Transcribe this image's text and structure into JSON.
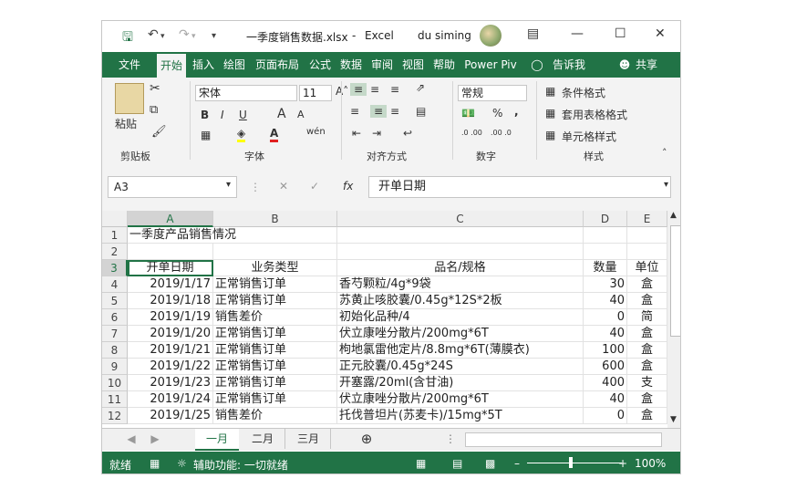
{
  "title_bar": {
    "file_name": "一季度销售数据.xlsx",
    "app": "Excel",
    "user": "du siming"
  },
  "tabs": [
    "文件",
    "开始",
    "插入",
    "绘图",
    "页面布局",
    "公式",
    "数据",
    "审阅",
    "视图",
    "帮助",
    "Power Piv",
    "告诉我",
    "共享"
  ],
  "ribbon": {
    "clipboard": {
      "paste": "粘贴",
      "label": "剪贴板"
    },
    "font": {
      "name": "宋体",
      "size": "11",
      "bold": "B",
      "italic": "I",
      "underline": "U",
      "grow": "A",
      "shrink": "A",
      "color": "A",
      "label": "字体"
    },
    "alignment": {
      "label": "对齐方式"
    },
    "number": {
      "format": "常规",
      "percent": "%",
      "comma": ",",
      "inc": ".0 .00",
      "dec": ".00 .0",
      "label": "数字"
    },
    "styles": {
      "conditional": "条件格式",
      "table": "套用表格格式",
      "cell": "单元格样式",
      "label": "样式"
    }
  },
  "formula_bar": {
    "name_box": "A3",
    "fx": "fx",
    "content": "开单日期"
  },
  "columns": [
    "A",
    "B",
    "C",
    "D",
    "E"
  ],
  "rows": [
    {
      "n": "1",
      "a": "一季度产品销售情况",
      "b": "",
      "c": "",
      "d": "",
      "e": ""
    },
    {
      "n": "2",
      "a": "",
      "b": "",
      "c": "",
      "d": "",
      "e": ""
    },
    {
      "n": "3",
      "a": "开单日期",
      "b": "业务类型",
      "c": "品名/规格",
      "d": "数量",
      "e": "单位"
    },
    {
      "n": "4",
      "a": "2019/1/17",
      "b": "正常销售订单",
      "c": "香芍颗粒/4g*9袋",
      "d": "30",
      "e": "盒"
    },
    {
      "n": "5",
      "a": "2019/1/18",
      "b": "正常销售订单",
      "c": "苏黄止咳胶囊/0.45g*12S*2板",
      "d": "40",
      "e": "盒"
    },
    {
      "n": "6",
      "a": "2019/1/19",
      "b": "销售差价",
      "c": "初始化品种/4",
      "d": "0",
      "e": "简"
    },
    {
      "n": "7",
      "a": "2019/1/20",
      "b": "正常销售订单",
      "c": "伏立康唑分散片/200mg*6T",
      "d": "40",
      "e": "盒"
    },
    {
      "n": "8",
      "a": "2019/1/21",
      "b": "正常销售订单",
      "c": "枸地氯雷他定片/8.8mg*6T(薄膜衣)",
      "d": "100",
      "e": "盒"
    },
    {
      "n": "9",
      "a": "2019/1/22",
      "b": "正常销售订单",
      "c": "正元胶囊/0.45g*24S",
      "d": "600",
      "e": "盒"
    },
    {
      "n": "10",
      "a": "2019/1/23",
      "b": "正常销售订单",
      "c": "开塞露/20ml(含甘油)",
      "d": "400",
      "e": "支"
    },
    {
      "n": "11",
      "a": "2019/1/24",
      "b": "正常销售订单",
      "c": "伏立康唑分散片/200mg*6T",
      "d": "40",
      "e": "盒"
    },
    {
      "n": "12",
      "a": "2019/1/25",
      "b": "销售差价",
      "c": "托伐普坦片(苏麦卡)/15mg*5T",
      "d": "0",
      "e": "盒"
    }
  ],
  "sheets": [
    "一月",
    "二月",
    "三月"
  ],
  "status_bar": {
    "ready": "就绪",
    "accessibility": "辅助功能: 一切就绪",
    "zoom": "100%"
  },
  "colors": {
    "accent": "#217346",
    "ribbon": "#f3f3f3"
  }
}
